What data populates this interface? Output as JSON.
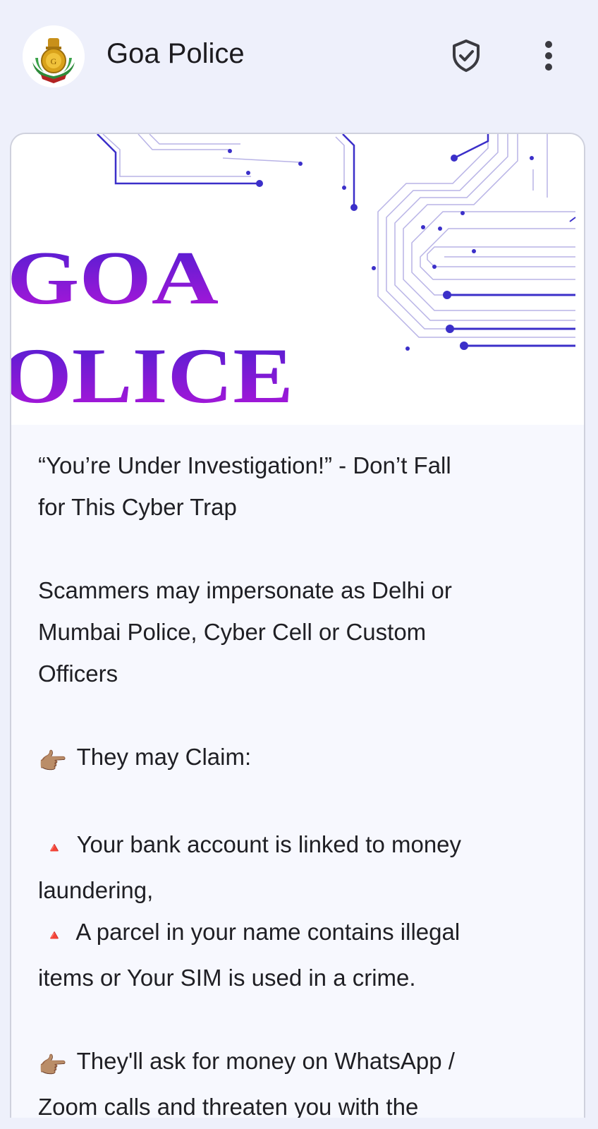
{
  "header": {
    "title": "Goa Police",
    "avatar_icon": "goa-police-emblem",
    "verified_icon": "shield-check-icon",
    "menu_icon": "more-vert-icon"
  },
  "banner": {
    "line1": "GOA",
    "line2": "OLICE",
    "gradient": [
      "#4b1fd1",
      "#b316d9"
    ]
  },
  "message": {
    "headline_line1": "“You’re Under Investigation!” - Don’t Fall",
    "headline_line2": "for This Cyber Trap",
    "p2_line1": "Scammers may impersonate as Delhi or",
    "p2_line2": "Mumbai Police, Cyber Cell or Custom",
    "p2_line3": "Officers",
    "claim_icon": "👉🏽",
    "claim_text": "They may Claim:",
    "bullet_icon": "🔺",
    "bullet1_line1": "Your bank account is linked to money",
    "bullet1_line2": "laundering,",
    "bullet2_line1": "A parcel in your name contains illegal",
    "bullet2_line2": "items or Your SIM is used in a crime.",
    "ask_icon": "👉🏽",
    "ask_line1": "They'll ask for money on WhatsApp /",
    "ask_line2": "Zoom calls and threaten you with the"
  },
  "colors": {
    "page_bg": "#eef0fb",
    "card_bg": "#f7f8fe",
    "circuit": "#3b2fc9",
    "bullet_red": "#e53935"
  }
}
